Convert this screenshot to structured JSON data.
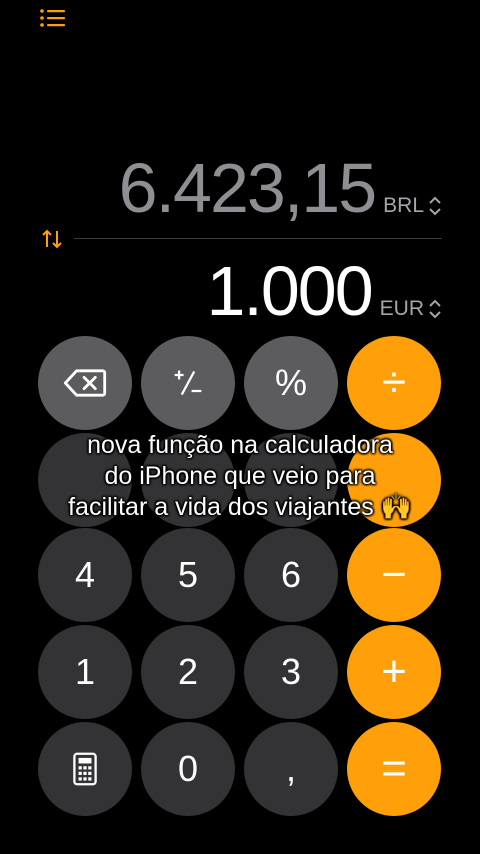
{
  "display": {
    "top_value": "6.423,15",
    "top_currency": "BRL",
    "bottom_value": "1.000",
    "bottom_currency": "EUR"
  },
  "keys": {
    "percent": "%",
    "divide": "÷",
    "digit_4": "4",
    "digit_5": "5",
    "digit_6": "6",
    "subtract": "−",
    "digit_1": "1",
    "digit_2": "2",
    "digit_3": "3",
    "add": "+",
    "digit_0": "0",
    "decimal": ",",
    "equals": "="
  },
  "caption": {
    "line1": "nova função na calculadora",
    "line2": "do iPhone que veio para",
    "line3": "facilitar a vida dos viajantes 🙌"
  },
  "colors": {
    "background": "#000000",
    "operator": "#ff9f0a",
    "function_key": "#5c5c5f",
    "number_key": "#333335"
  }
}
